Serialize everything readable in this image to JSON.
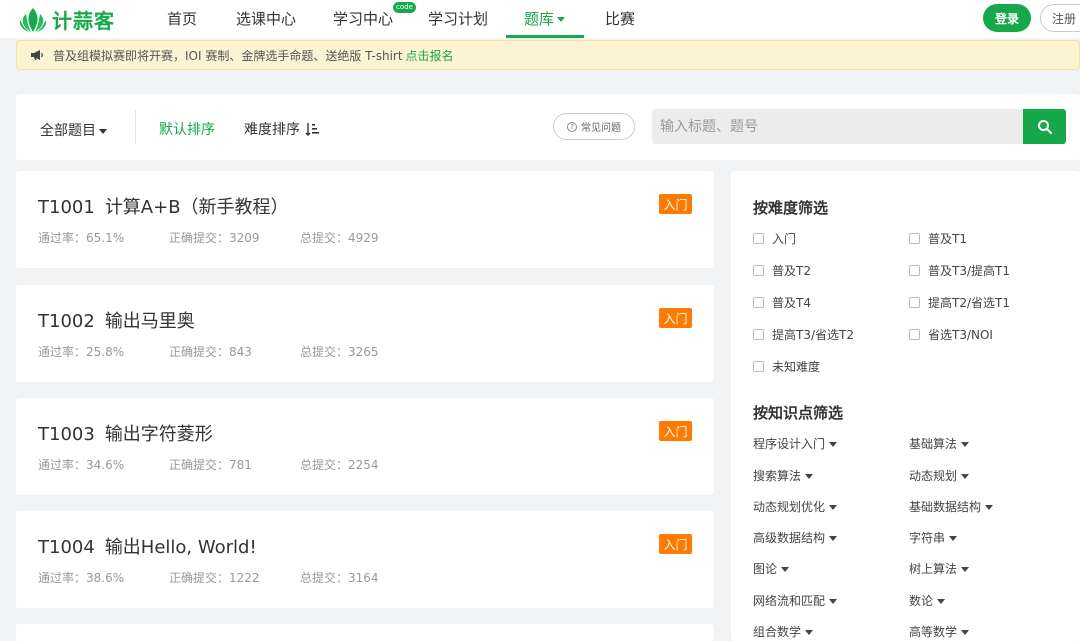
{
  "nav": {
    "logo_text": "计蒜客",
    "items": [
      "首页",
      "选课中心",
      "学习中心",
      "学习计划",
      "题库",
      "比赛"
    ],
    "new_badge": "code",
    "login": "登录",
    "register": "注册"
  },
  "notice": {
    "text": "普及组模拟赛即将开赛，IOI 赛制、金牌选手命题、送绝版 T-shirt",
    "link": "点击报名"
  },
  "filter": {
    "all_problems": "全部题目",
    "default_sort": "默认排序",
    "difficulty_sort": "难度排序",
    "faq": "常见问题",
    "search_placeholder": "输入标题、题号"
  },
  "problems": [
    {
      "id": "T1001",
      "title": "计算A+B（新手教程）",
      "pass_rate": "通过率：65.1%",
      "correct": "正确提交：3209",
      "total": "总提交：4929",
      "level": "入门"
    },
    {
      "id": "T1002",
      "title": "输出马里奥",
      "pass_rate": "通过率：25.8%",
      "correct": "正确提交：843",
      "total": "总提交：3265",
      "level": "入门"
    },
    {
      "id": "T1003",
      "title": "输出字符菱形",
      "pass_rate": "通过率：34.6%",
      "correct": "正确提交：781",
      "total": "总提交：2254",
      "level": "入门"
    },
    {
      "id": "T1004",
      "title": "输出Hello, World!",
      "pass_rate": "通过率：38.6%",
      "correct": "正确提交：1222",
      "total": "总提交：3164",
      "level": "入门"
    }
  ],
  "side": {
    "difficulty_title": "按难度筛选",
    "difficulties": [
      "入门",
      "普及T1",
      "普及T2",
      "普及T3/提高T1",
      "普及T4",
      "提高T2/省选T1",
      "提高T3/省选T2",
      "省选T3/NOI",
      "未知难度"
    ],
    "knowledge_title": "按知识点筛选",
    "knowledge": [
      "程序设计入门",
      "基础算法",
      "搜索算法",
      "动态规划",
      "动态规划优化",
      "基础数据结构",
      "高级数据结构",
      "字符串",
      "图论",
      "树上算法",
      "网络流和匹配",
      "数论",
      "组合数学",
      "高等数学"
    ]
  },
  "colors": {
    "brand": "#17a84b",
    "badge": "#ff7a00",
    "notice_bg": "#fcf3d2"
  }
}
